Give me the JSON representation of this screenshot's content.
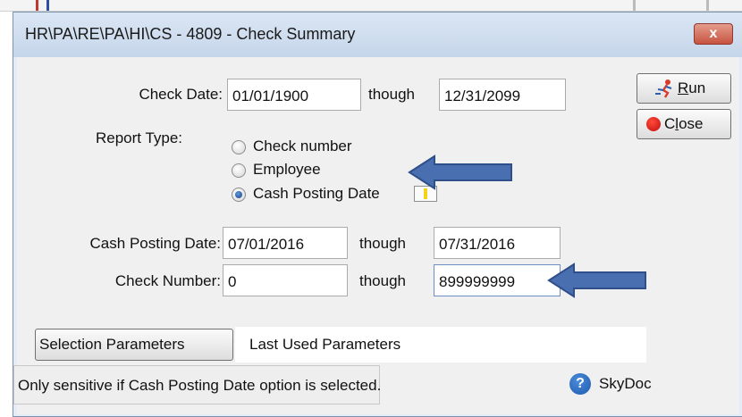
{
  "window": {
    "title": "HR\\PA\\RE\\PA\\HI\\CS - 4809 - Check Summary",
    "close_glyph": "x"
  },
  "check_date": {
    "label": "Check Date:",
    "from": "01/01/1900",
    "through_label": "though",
    "to": "12/31/2099"
  },
  "report_type": {
    "label": "Report Type:",
    "options": [
      {
        "label": "Check number",
        "selected": false
      },
      {
        "label": "Employee",
        "selected": false
      },
      {
        "label": "Cash Posting Date",
        "selected": true
      }
    ]
  },
  "cash_posting_date": {
    "label": "Cash Posting Date:",
    "from": "07/01/2016",
    "through_label": "though",
    "to": "07/31/2016"
  },
  "check_number": {
    "label": "Check Number:",
    "from": "0",
    "through_label": "though",
    "to": "899999999"
  },
  "buttons": {
    "run": {
      "prefix": "",
      "hotkey": "R",
      "rest": "un",
      "icon": "run-icon"
    },
    "close": {
      "prefix": "C",
      "hotkey": "l",
      "rest": "ose",
      "icon": "red-dot-icon"
    }
  },
  "selection": {
    "button_label": "Selection Parameters",
    "value": "Last Used Parameters"
  },
  "status_text": "Only sensitive if Cash Posting Date option is selected.",
  "help": {
    "icon_glyph": "?",
    "label": "SkyDoc"
  },
  "colors": {
    "annotation_arrow": "#4a6fb0",
    "titlebar": "#c9d9ec",
    "close_button": "#c75340",
    "radio_selected": "#1f4f9a"
  }
}
